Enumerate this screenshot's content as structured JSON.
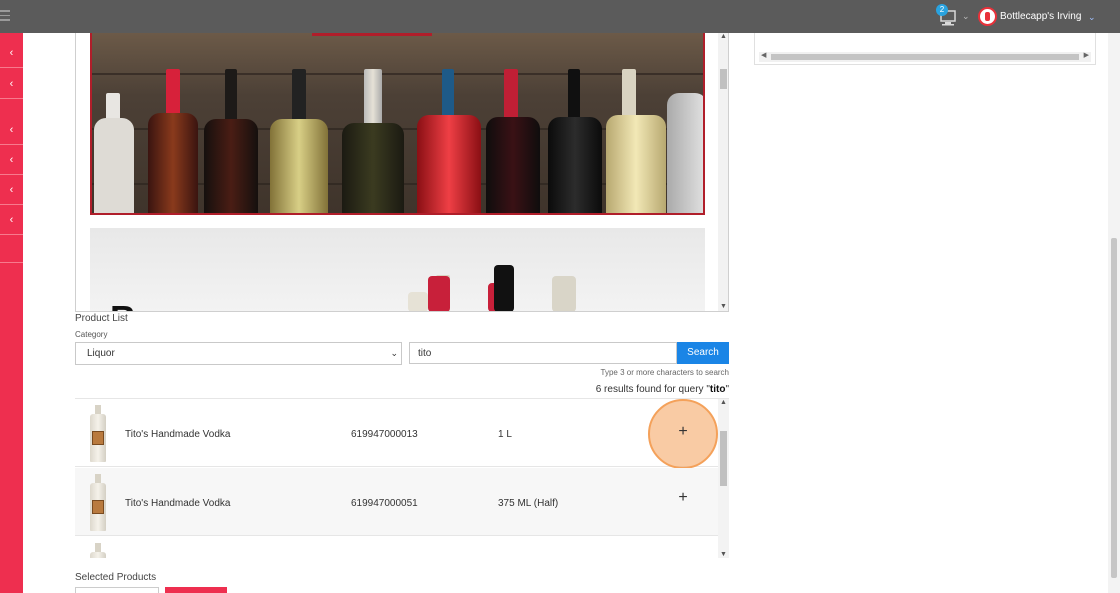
{
  "topbar": {
    "notification_count": "2",
    "store_name": "Bottlecapp's Irving"
  },
  "sidebar": {
    "items": [
      {
        "icon": "chevron-left-icon"
      },
      {
        "icon": "chevron-left-icon"
      },
      {
        "icon": "chevron-left-icon"
      },
      {
        "icon": "chevron-left-icon"
      },
      {
        "icon": "chevron-left-icon"
      },
      {
        "icon": "chevron-left-icon"
      }
    ]
  },
  "product_list": {
    "title": "Product List",
    "category_label": "Category",
    "category_value": "Liquor",
    "search_value": "tito",
    "search_button": "Search",
    "hint": "Type 3 or more characters to search",
    "results_prefix": "6 results found for query \"",
    "results_query": "tito",
    "results_suffix": "\"",
    "rows": [
      {
        "name": "Tito's Handmade Vodka",
        "upc": "619947000013",
        "size": "1 L",
        "add": "+"
      },
      {
        "name": "Tito's Handmade Vodka",
        "upc": "619947000051",
        "size": "375 ML (Half)",
        "add": "+"
      }
    ]
  },
  "selected_products": {
    "title": "Selected Products"
  },
  "colors": {
    "topbar": "#5b5b5b",
    "rail": "#ee2f4f",
    "search_button": "#1a85e6",
    "highlight": "#f4a15a"
  }
}
